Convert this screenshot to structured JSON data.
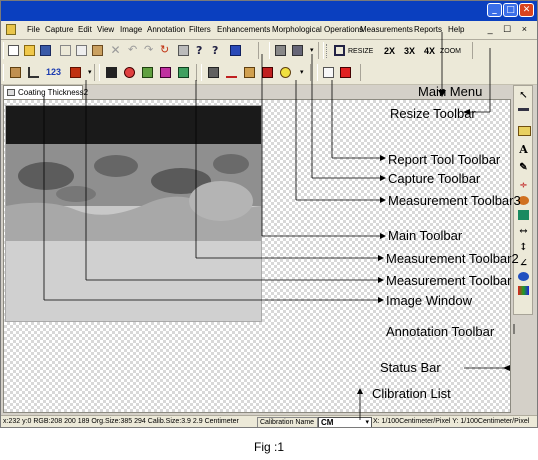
{
  "window": {
    "min_glyph": "_",
    "max_glyph": "□",
    "close_glyph": "✕"
  },
  "menu": {
    "items": [
      "File",
      "Capture",
      "Edit",
      "View",
      "Image",
      "Annotation",
      "Filters",
      "Enhancements",
      "Morphological Operations",
      "Measurements",
      "Reports",
      "Help"
    ],
    "mdi_controls": "_ ☐ ×"
  },
  "resize_toolbar": {
    "resize": "RESIZE",
    "x2": "2X",
    "x3": "3X",
    "x4": "4X",
    "zoom": "ZOOM"
  },
  "measure_toolbar": {
    "count_label": "123"
  },
  "document": {
    "tab": "Coating Thickness2"
  },
  "annotation_toolbar": {
    "text_tool": "A"
  },
  "status": {
    "info": "x:232 y:0 RGB:208 200 189 Org.Size:385 294 Calib.Size:3.9 2.9 Centimeter",
    "calibration_name": "Calibration Name",
    "calibration_value": "CM",
    "pixel_scale": "X: 1/100Centimeter/Pixel Y: 1/100Centimeter/Pixel"
  },
  "callouts": {
    "main_menu": "Main Menu",
    "resize_toolbar": "Resize Toolbar",
    "report_tool_toolbar": "Report Tool Toolbar",
    "capture_toolbar": "Capture Toolbar",
    "measurement_toolbar3": "Measurement Toolbar3",
    "main_toolbar": "Main Toolbar",
    "measurement_toolbar2": "Measurement Toolbar2",
    "measurement_toolbar": "Measurement Toolbar",
    "image_window": "Image Window",
    "annotation_toolbar": "Annotation Toolbar",
    "status_bar": "Status Bar",
    "calibration_list": "Clibration List"
  },
  "caption": "Fig :1",
  "colors": {
    "title_bar": "#0a3fbf",
    "chrome": "#ece9d8",
    "close_button": "#d9441e"
  }
}
